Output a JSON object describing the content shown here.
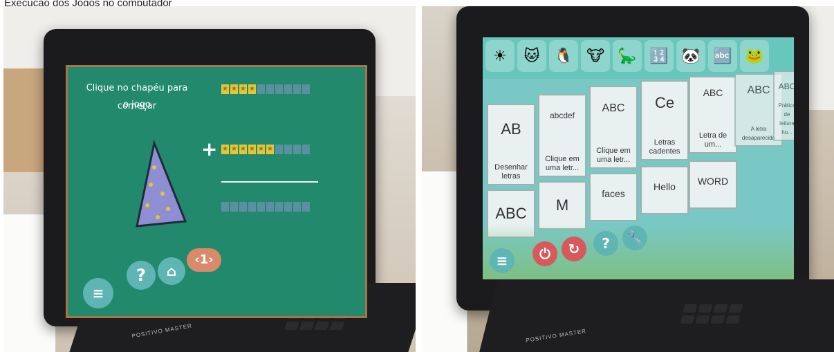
{
  "caption": "Execução dos Jogos no computador",
  "photo_left": {
    "screen": {
      "instruction_line1": "Clique no chapéu para começar",
      "instruction_line2": "o jogo",
      "plus_sign": "+",
      "page_number": "1",
      "help_symbol": "?",
      "stars_row1": 4,
      "stars_row2": 6,
      "cells_per_row": 10
    },
    "brand": "POSITIVO MASTER"
  },
  "photo_right": {
    "screen": {
      "tiles": [
        {
          "label": "Desenhar letras",
          "icon": "AB"
        },
        {
          "label": "Clique em uma letr...",
          "icon": "abcdef"
        },
        {
          "label": "Clique em uma letr...",
          "icon": "ABC"
        },
        {
          "label": "Letras cadentes",
          "icon": "Ce"
        },
        {
          "label": "Letra de um...",
          "icon": "ABC"
        },
        {
          "label": "A letra desaparecida",
          "icon": "ABC"
        },
        {
          "label": "Prática de leitura ho...",
          "icon": "ABC"
        }
      ],
      "bottom_tiles": [
        "ABC",
        "M",
        "faces",
        "Hello",
        "WORD"
      ],
      "buttons": [
        "?",
        "wrench"
      ]
    },
    "brand": "POSITIVO MASTER"
  },
  "colors": {
    "board_green": "#22896c",
    "frame_brown": "#a9744a",
    "star_yellow": "#e4c63a",
    "app_teal": "#7ac8c5",
    "button_red": "#d8595b",
    "button_teal": "#5fb5b3"
  }
}
